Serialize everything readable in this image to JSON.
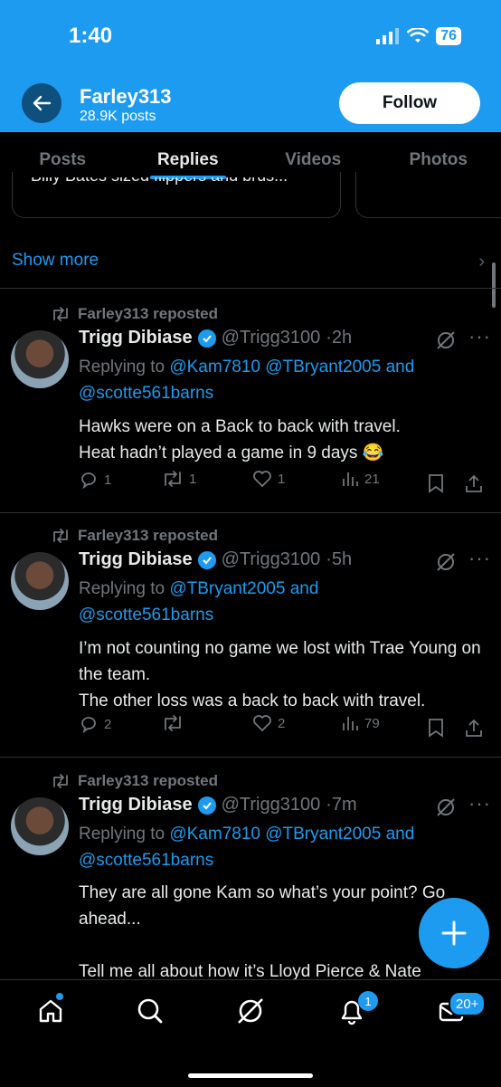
{
  "status_bar": {
    "time": "1:40",
    "battery": "76"
  },
  "header": {
    "name": "Farley313",
    "posts_count": "28.9K posts",
    "follow_label": "Follow"
  },
  "tabs": [
    {
      "label": "Posts"
    },
    {
      "label": "Replies"
    },
    {
      "label": "Videos"
    },
    {
      "label": "Photos"
    }
  ],
  "card_fragment_text": "Billy Bates sized flippers and brus...",
  "show_more_label": "Show more",
  "tweets": [
    {
      "repost_label": "Farley313 reposted",
      "author": "Trigg Dibiase",
      "handle": "@Trigg3100",
      "time": "·2h",
      "replying_prefix": "Replying to",
      "replying_mentions": "@Kam7810 @TBryant2005 and @scotte561barns",
      "text": "Hawks were on a Back to back with travel.\nHeat hadn’t played a game in 9 days 😂",
      "replies": "1",
      "reposts": "1",
      "likes": "1",
      "views": "21"
    },
    {
      "repost_label": "Farley313 reposted",
      "author": "Trigg Dibiase",
      "handle": "@Trigg3100",
      "time": "·5h",
      "replying_prefix": "Replying to",
      "replying_mentions": "@TBryant2005 and @scotte561barns",
      "text": "I’m not counting no game we lost with Trae Young on the team.\nThe other loss was a back to back with travel.",
      "replies": "2",
      "reposts": "",
      "likes": "2",
      "views": "79"
    },
    {
      "repost_label": "Farley313 reposted",
      "author": "Trigg Dibiase",
      "handle": "@Trigg3100",
      "time": "·7m",
      "replying_prefix": "Replying to",
      "replying_mentions": "@Kam7810 @TBryant2005 and @scotte561barns",
      "text": "They are all gone Kam so what’s your point? Go ahead...\n\nTell me all about how it’s Lloyd Pierce & Nate"
    }
  ],
  "bottom_nav": {
    "notifications_badge": "1",
    "messages_badge": "20+"
  },
  "colors": {
    "accent": "#1d9bf0",
    "background": "#000000",
    "muted": "#71767b"
  }
}
